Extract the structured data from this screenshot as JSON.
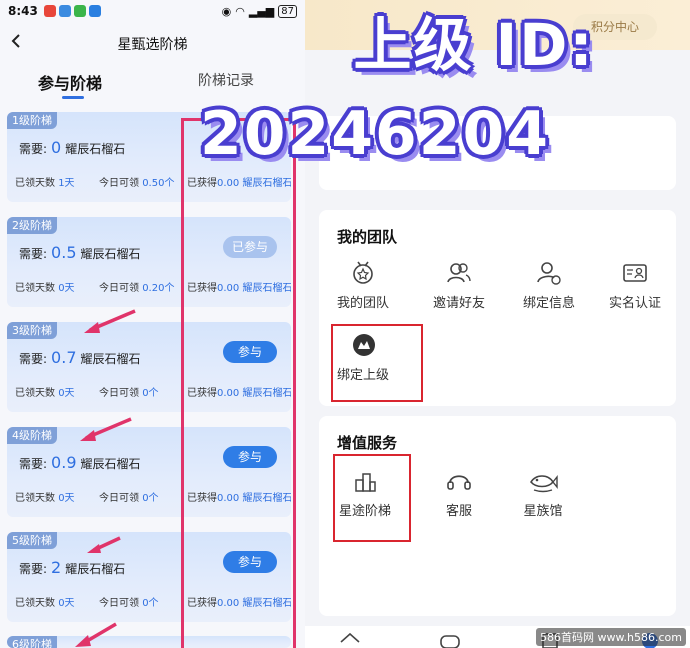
{
  "statusbar": {
    "time": "8:43",
    "battery": "87"
  },
  "nav": {
    "title": "星甄选阶梯"
  },
  "tabs": {
    "active": "参与阶梯",
    "inactive": "阶梯记录"
  },
  "cards": [
    {
      "level": "1级阶梯",
      "need_label": "需要:",
      "need_value": "0",
      "unit": "耀辰石榴石",
      "button": "",
      "days_label": "已领天数",
      "days": "1天",
      "today_label": "今日可领",
      "today": "0.50个",
      "got_label": "已获得",
      "got": "0.00 耀辰石榴石"
    },
    {
      "level": "2级阶梯",
      "need_label": "需要:",
      "need_value": "0.5",
      "unit": "耀辰石榴石",
      "button": "已参与",
      "days_label": "已领天数",
      "days": "0天",
      "today_label": "今日可领",
      "today": "0.20个",
      "got_label": "已获得",
      "got": "0.00 耀辰石榴石"
    },
    {
      "level": "3级阶梯",
      "need_label": "需要:",
      "need_value": "0.7",
      "unit": "耀辰石榴石",
      "button": "参与",
      "days_label": "已领天数",
      "days": "0天",
      "today_label": "今日可领",
      "today": "0个",
      "got_label": "已获得",
      "got": "0.00 耀辰石榴石"
    },
    {
      "level": "4级阶梯",
      "need_label": "需要:",
      "need_value": "0.9",
      "unit": "耀辰石榴石",
      "button": "参与",
      "days_label": "已领天数",
      "days": "0天",
      "today_label": "今日可领",
      "today": "0个",
      "got_label": "已获得",
      "got": "0.00 耀辰石榴石"
    },
    {
      "level": "5级阶梯",
      "need_label": "需要:",
      "need_value": "2",
      "unit": "耀辰石榴石",
      "button": "参与",
      "days_label": "已领天数",
      "days": "0天",
      "today_label": "今日可领",
      "today": "0个",
      "got_label": "已获得",
      "got": "0.00 耀辰石榴石"
    },
    {
      "level": "6级阶梯",
      "need_label": "",
      "need_value": "",
      "unit": "",
      "button": "",
      "days_label": "",
      "days": "",
      "today_label": "",
      "today": "",
      "got_label": "",
      "got": ""
    }
  ],
  "right": {
    "points_center": "积分中心",
    "team": {
      "title": "我的团队",
      "items": [
        "我的团队",
        "邀请好友",
        "绑定信息",
        "实名认证",
        "绑定上级"
      ]
    },
    "services": {
      "title": "增值服务",
      "items": [
        "星途阶梯",
        "客服",
        "星族馆"
      ]
    }
  },
  "overlay": {
    "line1": "上级 ID:",
    "line2": "20246204"
  },
  "watermark": "586首码网 www.h586.com"
}
